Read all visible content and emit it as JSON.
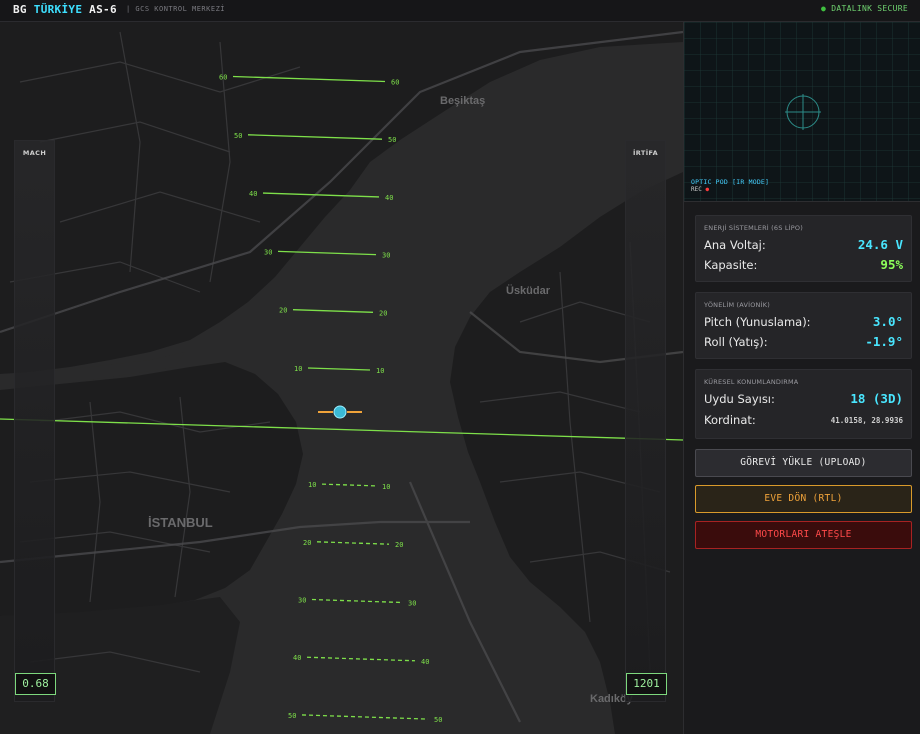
{
  "header": {
    "brand_part1": "BG ",
    "brand_part2": "TÜRKİYE",
    "brand_part3": " AS-6",
    "subtitle": "| GCS KONTROL MERKEZİ",
    "datalink_dot": "●",
    "datalink_text": "DATALINK SECURE"
  },
  "map": {
    "place_labels": [
      "Beşiktaş",
      "Üsküdar",
      "İSTANBUL",
      "Kadıköy"
    ],
    "pitch_ladder_up": [
      60,
      50,
      40,
      30,
      20,
      10
    ],
    "pitch_ladder_down": [
      10,
      20,
      30,
      40,
      50
    ],
    "horizon_color": "#7ee04a",
    "ladder_color": "#7ee04a"
  },
  "tapes": {
    "speed": {
      "title": "MACH",
      "value": "0.68"
    },
    "altitude": {
      "title": "İRTİFA",
      "value": "1201"
    }
  },
  "camera": {
    "mode_label": "OPTIC POD [IR MODE]",
    "rec_label": "REC",
    "rec_dot": "●"
  },
  "power": {
    "title": "ENERJİ SİSTEMLERİ (6S LİPO)",
    "voltage_label": "Ana Voltaj:",
    "voltage_value": "24.6 V",
    "capacity_label": "Kapasite:",
    "capacity_value": "95%"
  },
  "attitude": {
    "title": "YÖNELİM (AVİONİK)",
    "pitch_label": "Pitch (Yunuslama):",
    "pitch_value": "3.0°",
    "roll_label": "Roll (Yatış):",
    "roll_value": "-1.9°"
  },
  "gps": {
    "title": "KÜRESEL KONUMLANDIRMA",
    "sats_label": "Uydu Sayısı:",
    "sats_value": "18 (3D)",
    "coord_label": "Kordinat:",
    "coord_value": "41.0158, 28.9936"
  },
  "actions": {
    "upload_label": "GÖREVİ YÜKLE (UPLOAD)",
    "rtl_label": "EVE DÖN (RTL)",
    "arm_label": "MOTORLARI ATEŞLE"
  },
  "colors": {
    "accent_cyan": "#3ee0ff",
    "ok_green": "#8dff5a",
    "warn_orange": "#f0a33a",
    "danger_red": "#ff4a4a"
  }
}
